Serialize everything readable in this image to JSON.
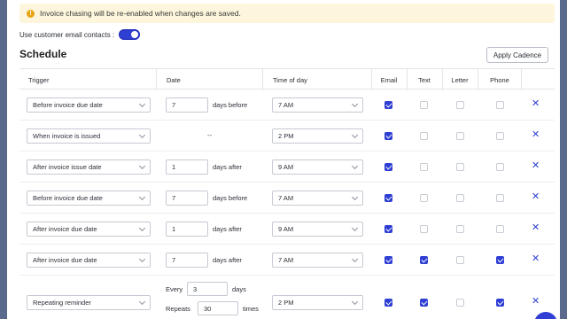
{
  "notice": {
    "text": "Invoice chasing will be re-enabled when changes are saved."
  },
  "contacts": {
    "label": "Use customer email contacts :",
    "enabled": true
  },
  "schedule": {
    "title": "Schedule",
    "apply_label": "Apply Cadence",
    "columns": {
      "trigger": "Trigger",
      "date": "Date",
      "time": "Time of day",
      "email": "Email",
      "text": "Text",
      "letter": "Letter",
      "phone": "Phone"
    },
    "rows": [
      {
        "trigger": "Before invoice due date",
        "days": "7",
        "suffix": "days before",
        "time": "7 AM",
        "email": true,
        "text": false,
        "letter": false,
        "phone": false
      },
      {
        "trigger": "When invoice is issued",
        "dash": "--",
        "time": "2 PM",
        "email": true,
        "text": false,
        "letter": false,
        "phone": false
      },
      {
        "trigger": "After invoice issue date",
        "days": "1",
        "suffix": "days after",
        "time": "9 AM",
        "email": true,
        "text": false,
        "letter": false,
        "phone": false
      },
      {
        "trigger": "Before invoice due date",
        "days": "7",
        "suffix": "days before",
        "time": "7 AM",
        "email": true,
        "text": false,
        "letter": false,
        "phone": false
      },
      {
        "trigger": "After invoice due date",
        "days": "1",
        "suffix": "days after",
        "time": "9 AM",
        "email": true,
        "text": false,
        "letter": false,
        "phone": false
      },
      {
        "trigger": "After invoice due date",
        "days": "7",
        "suffix": "days after",
        "time": "7 AM",
        "email": true,
        "text": true,
        "letter": false,
        "phone": true
      }
    ],
    "repeating": {
      "trigger": "Repeating reminder",
      "every_label": "Every",
      "every_value": "3",
      "every_suffix": "days",
      "repeats_label": "Repeats",
      "repeats_value": "30",
      "repeats_suffix": "times",
      "time": "2 PM",
      "email": true,
      "text": true,
      "letter": false,
      "phone": true
    }
  }
}
